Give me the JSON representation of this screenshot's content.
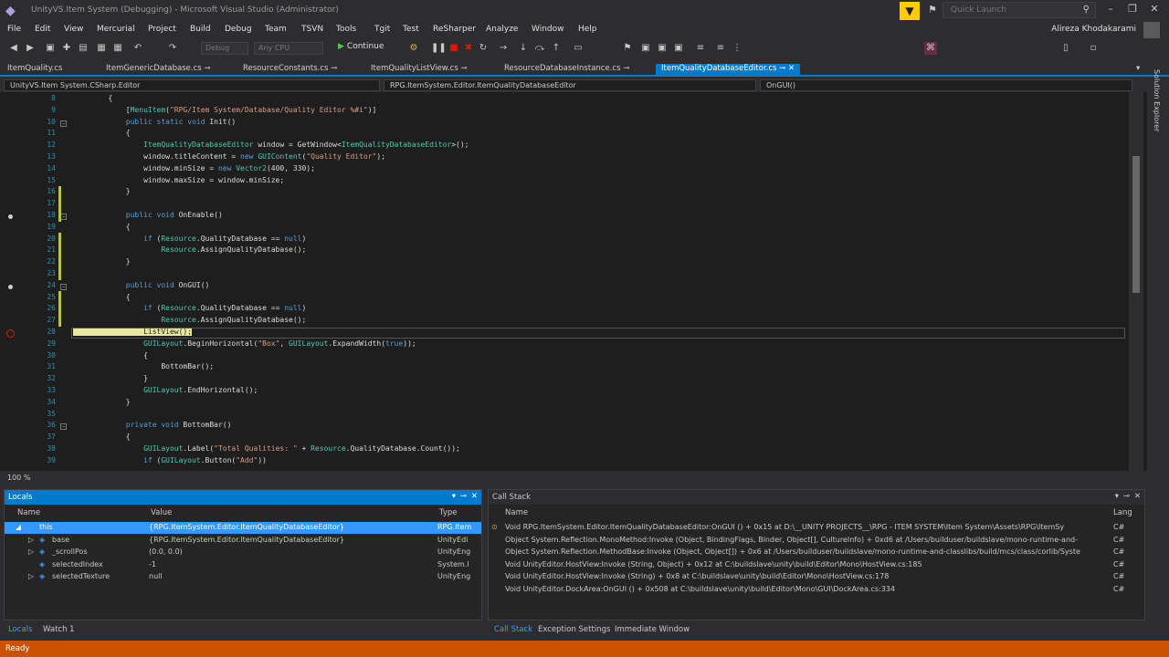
{
  "window": {
    "title": "UnityVS.Item System (Debugging) - Microsoft Visual Studio (Administrator)",
    "quick_launch": "Quick Launch"
  },
  "menu": [
    "File",
    "Edit",
    "View",
    "Mercurial",
    "Project",
    "Build",
    "Debug",
    "Team",
    "TSVN",
    "Tools",
    "Tgit",
    "Test",
    "ReSharper",
    "Analyze",
    "Window",
    "Help"
  ],
  "user": "Alireza Khodakarami",
  "toolbar": {
    "config": "Debug",
    "platform": "Any CPU",
    "continue_label": "Continue"
  },
  "doc_tabs": [
    {
      "label": "ItemQuality.cs",
      "active": false
    },
    {
      "label": "ItemGenericDatabase.cs",
      "active": false
    },
    {
      "label": "ResourceConstants.cs",
      "active": false
    },
    {
      "label": "ItemQualityListView.cs",
      "active": false
    },
    {
      "label": "ResourceDatabaseInstance.cs",
      "active": false
    },
    {
      "label": "ItemQualityDatabaseEditor.cs",
      "active": true
    }
  ],
  "nav": {
    "project": "UnityVS.Item System.CSharp.Editor",
    "type": "RPG.ItemSystem.Editor.ItemQualityDatabaseEditor",
    "member": "OnGUI()"
  },
  "side_panel_label": "Solution Explorer",
  "zoom": "100 %",
  "locals": {
    "title": "Locals",
    "columns": [
      "Name",
      "Value",
      "Type"
    ],
    "rows": [
      {
        "name": "this",
        "value": "{RPG.ItemSystem.Editor.ItemQualityDatabaseEditor}",
        "type": "RPG.Item",
        "selected": true
      },
      {
        "name": "base",
        "value": "{RPG.ItemSystem.Editor.ItemQualityDatabaseEditor}",
        "type": "UnityEdi",
        "selected": false
      },
      {
        "name": "_scrollPos",
        "value": "(0.0, 0.0)",
        "type": "UnityEng",
        "selected": false
      },
      {
        "name": "selectedIndex",
        "value": "-1",
        "type": "System.I",
        "selected": false
      },
      {
        "name": "selectedTexture",
        "value": "null",
        "type": "UnityEng",
        "selected": false
      }
    ],
    "tabs": [
      "Locals",
      "Watch 1"
    ]
  },
  "callstack": {
    "title": "Call Stack",
    "columns": [
      "Name",
      "Lang"
    ],
    "rows": [
      {
        "name": "Void RPG.ItemSystem.Editor.ItemQualityDatabaseEditor:OnGUI () + 0x15 at D:\\__UNITY PROJECTS__\\RPG - ITEM SYSTEM\\Item System\\Assets\\RPG\\ItemSy",
        "lang": "C#"
      },
      {
        "name": "Object System.Reflection.MonoMethod:Invoke (Object, BindingFlags, Binder, Object[], CultureInfo) + 0xd6 at /Users/builduser/buildslave/mono-runtime-and-",
        "lang": "C#"
      },
      {
        "name": "Object System.Reflection.MethodBase:Invoke (Object, Object[]) + 0x6 at /Users/builduser/buildslave/mono-runtime-and-classlibs/build/mcs/class/corlib/Syste",
        "lang": "C#"
      },
      {
        "name": "Void UnityEditor.HostView:Invoke (String, Object) + 0x12 at C:\\buildslave\\unity\\build\\Editor\\Mono\\HostView.cs:185",
        "lang": "C#"
      },
      {
        "name": "Void UnityEditor.HostView:Invoke (String) + 0x8 at C:\\buildslave\\unity\\build\\Editor\\Mono\\HostView.cs:178",
        "lang": "C#"
      },
      {
        "name": "Void UnityEditor.DockArea:OnGUI () + 0x508 at C:\\buildslave\\unity\\build\\Editor\\Mono\\GUI\\DockArea.cs:334",
        "lang": "C#"
      }
    ],
    "tabs": [
      "Call Stack",
      "Exception Settings",
      "Immediate Window"
    ]
  },
  "status": "Ready",
  "code_lines": [
    {
      "n": "8",
      "t": "        {"
    },
    {
      "n": "9",
      "t": "            [MenuItem(\"RPG/Item System/Database/Quality Editor %#i\")]"
    },
    {
      "n": "10",
      "t": "            public static void Init()"
    },
    {
      "n": "11",
      "t": "            {"
    },
    {
      "n": "12",
      "t": "                ItemQualityDatabaseEditor window = GetWindow<ItemQualityDatabaseEditor>();"
    },
    {
      "n": "13",
      "t": "                window.titleContent = new GUIContent(\"Quality Editor\");"
    },
    {
      "n": "14",
      "t": "                window.minSize = new Vector2(400, 330);"
    },
    {
      "n": "15",
      "t": "                window.maxSize = window.minSize;"
    },
    {
      "n": "16",
      "t": "            }"
    },
    {
      "n": "17",
      "t": ""
    },
    {
      "n": "18",
      "t": "            public void OnEnable()"
    },
    {
      "n": "19",
      "t": "            {"
    },
    {
      "n": "20",
      "t": "                if (Resource.QualityDatabase == null)"
    },
    {
      "n": "21",
      "t": "                    Resource.AssignQualityDatabase();"
    },
    {
      "n": "22",
      "t": "            }"
    },
    {
      "n": "23",
      "t": ""
    },
    {
      "n": "24",
      "t": "            public void OnGUI()"
    },
    {
      "n": "25",
      "t": "            {"
    },
    {
      "n": "26",
      "t": "                if (Resource.QualityDatabase == null)"
    },
    {
      "n": "27",
      "t": "                    Resource.AssignQualityDatabase();"
    },
    {
      "n": "28",
      "t": "                ListView();"
    },
    {
      "n": "29",
      "t": "                GUILayout.BeginHorizontal(\"Box\", GUILayout.ExpandWidth(true));"
    },
    {
      "n": "30",
      "t": "                {"
    },
    {
      "n": "31",
      "t": "                    BottomBar();"
    },
    {
      "n": "32",
      "t": "                }"
    },
    {
      "n": "33",
      "t": "                GUILayout.EndHorizontal();"
    },
    {
      "n": "34",
      "t": "            }"
    },
    {
      "n": "35",
      "t": ""
    },
    {
      "n": "36",
      "t": "            private void BottomBar()"
    },
    {
      "n": "37",
      "t": "            {"
    },
    {
      "n": "38",
      "t": "                GUILayout.Label(\"Total Qualities: \" + Resource.QualityDatabase.Count());"
    },
    {
      "n": "39",
      "t": "                if (GUILayout.Button(\"Add\"))"
    }
  ]
}
